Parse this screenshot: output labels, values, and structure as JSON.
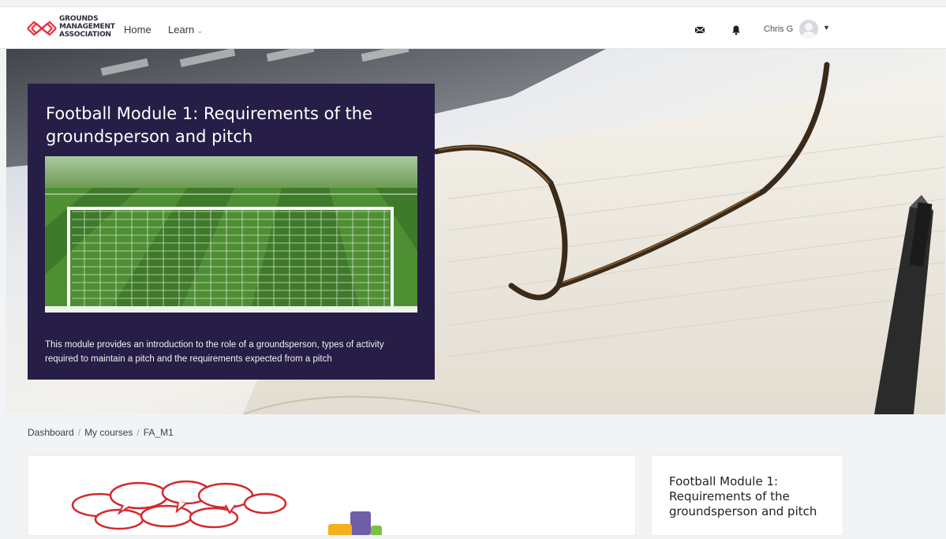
{
  "brand": {
    "logo_line1": "GROUNDS",
    "logo_line2": "MANAGEMENT",
    "logo_line3": "ASSOCIATION",
    "accent_color": "#e8313d"
  },
  "nav": {
    "home": "Home",
    "learn": "Learn",
    "learn_icon": "chevron-down-icon",
    "messages_icon": "envelope-icon",
    "notifications_icon": "bell-icon",
    "user_name": "Chris G",
    "user_menu_icon": "caret-down-icon"
  },
  "hero": {
    "title": "Football Module 1: Requirements of the groundsperson and pitch",
    "description": "This module provides an introduction to the role of a groundsperson, types of activity required to maintain a pitch and the requirements expected from a pitch",
    "card_color": "#271e47"
  },
  "breadcrumb": {
    "items": [
      "Dashboard",
      "My courses",
      "FA_M1"
    ],
    "separator": "/"
  },
  "sidebar": {
    "title": "Football Module 1: Requirements of the groundsperson and pitch"
  }
}
